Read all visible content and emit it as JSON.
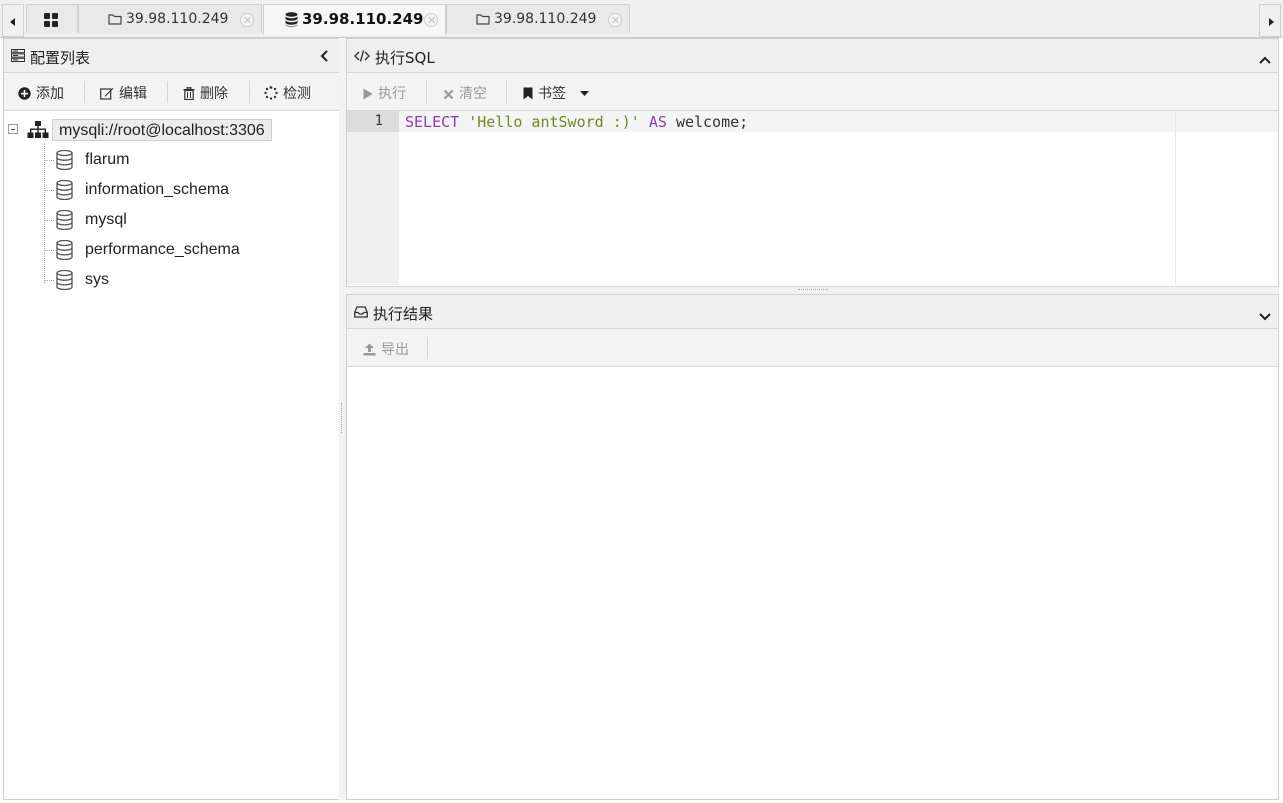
{
  "tabs": [
    {
      "icon": "grid-icon",
      "label": ""
    },
    {
      "icon": "folder-icon",
      "label": "39.98.110.249"
    },
    {
      "icon": "database-icon",
      "label": "39.98.110.249",
      "active": true
    },
    {
      "icon": "folder-icon",
      "label": "39.98.110.249"
    }
  ],
  "left_panel": {
    "title": "配置列表",
    "toolbar": {
      "add": "添加",
      "edit": "编辑",
      "delete": "删除",
      "test": "检测"
    },
    "tree": {
      "root": "mysqli://root@localhost:3306",
      "databases": [
        "flarum",
        "information_schema",
        "mysql",
        "performance_schema",
        "sys"
      ]
    }
  },
  "sql_panel": {
    "title": "执行SQL",
    "toolbar": {
      "execute": "执行",
      "clear": "清空",
      "bookmark": "书签"
    },
    "editor": {
      "line_number": "1",
      "kw_select": "SELECT",
      "string": "'Hello antSword :)'",
      "kw_as": "AS",
      "rest": "welcome;"
    }
  },
  "result_panel": {
    "title": "执行结果",
    "toolbar": {
      "export": "导出"
    }
  },
  "colors": {
    "keyword": "#8a3fb3",
    "string": "#6f8a1c",
    "panel_header": "#efefef",
    "disabled_text": "#9a9a9a"
  }
}
